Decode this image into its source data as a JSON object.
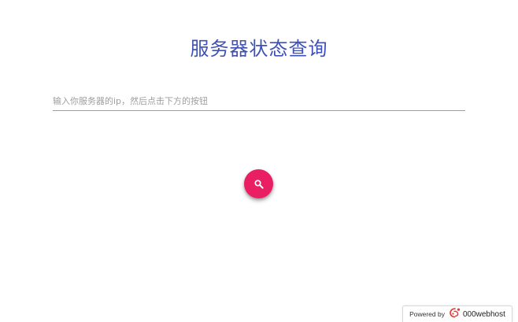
{
  "page": {
    "title": "服务器状态查询"
  },
  "search": {
    "placeholder": "输入你服务器的ip，然后点击下方的按钮",
    "value": ""
  },
  "search_button": {
    "icon": "search-icon",
    "color": "#e91e63"
  },
  "footer": {
    "powered_by_label": "Powered by",
    "brand_name": "000webhost",
    "brand_icon": "000webhost-logo-icon"
  },
  "colors": {
    "title": "#3f51b5",
    "accent": "#e91e63",
    "input_underline": "#9e9e9e"
  }
}
